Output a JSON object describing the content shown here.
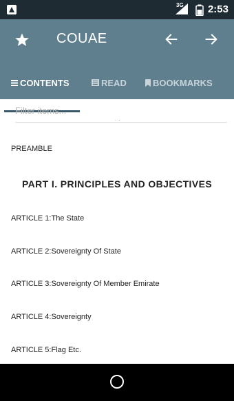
{
  "status_bar": {
    "network": "3G",
    "time": "2:53"
  },
  "app_bar": {
    "title": "COUAE",
    "icons": [
      "star-icon",
      "arrow-left-icon",
      "arrow-right-icon"
    ]
  },
  "tabs": [
    {
      "label": "CONTENTS",
      "icon": "list-icon",
      "active": true
    },
    {
      "label": "READ",
      "icon": "book-icon",
      "active": false
    },
    {
      "label": "BOOKMARKS",
      "icon": "bookmark-icon",
      "active": false
    }
  ],
  "filter": {
    "placeholder": "Filter items...",
    "value": ""
  },
  "contents": {
    "preamble": "PREAMBLE",
    "part_heading": "PART I. PRINCIPLES AND OBJECTIVES",
    "articles": [
      "ARTICLE 1:The State",
      "ARTICLE 2:Sovereignty Of State",
      "ARTICLE 3:Sovereignty Of Member Emirate",
      "ARTICLE 4:Sovereignty",
      "ARTICLE 5:Flag Etc."
    ]
  },
  "colors": {
    "app_bar": "#5f7f8f",
    "tab_indicator": "#3b5968",
    "status_bar": "#1e2b33"
  }
}
